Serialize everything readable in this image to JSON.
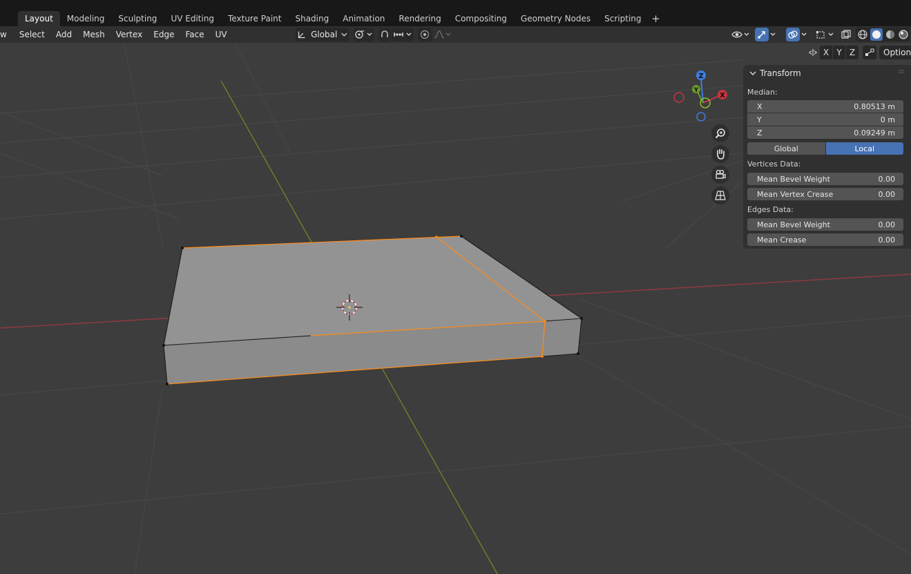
{
  "workspace_tabs": [
    {
      "label": "Layout",
      "active": true
    },
    {
      "label": "Modeling"
    },
    {
      "label": "Sculpting"
    },
    {
      "label": "UV Editing"
    },
    {
      "label": "Texture Paint"
    },
    {
      "label": "Shading"
    },
    {
      "label": "Animation"
    },
    {
      "label": "Rendering"
    },
    {
      "label": "Compositing"
    },
    {
      "label": "Geometry Nodes"
    },
    {
      "label": "Scripting"
    }
  ],
  "add_tab_label": "+",
  "header": {
    "view_cut": "w",
    "menus": [
      "Select",
      "Add",
      "Mesh",
      "Vertex",
      "Edge",
      "Face",
      "UV"
    ],
    "orientation": "Global"
  },
  "axis_toggles": [
    "X",
    "Y",
    "Z"
  ],
  "options_label": "Options",
  "gizmo": {
    "x": "X",
    "y": "Y",
    "z": "Z"
  },
  "transform_panel": {
    "title": "Transform",
    "median_label": "Median:",
    "x": {
      "label": "X",
      "value": "0.80513 m"
    },
    "y": {
      "label": "Y",
      "value": "0 m"
    },
    "z": {
      "label": "Z",
      "value": "0.09249 m"
    },
    "space_global": "Global",
    "space_local": "Local",
    "vertices_label": "Vertices Data:",
    "v_bevel": {
      "label": "Mean Bevel Weight",
      "value": "0.00"
    },
    "v_crease": {
      "label": "Mean Vertex Crease",
      "value": "0.00"
    },
    "edges_label": "Edges Data:",
    "e_bevel": {
      "label": "Mean Bevel Weight",
      "value": "0.00"
    },
    "e_crease": {
      "label": "Mean Crease",
      "value": "0.00"
    }
  },
  "colors": {
    "accent": "#4772b3",
    "selected_edge": "#ff8c1a",
    "x_axis": "#c4363f",
    "y_axis": "#6b9a2a",
    "z_axis": "#3d7de0"
  }
}
